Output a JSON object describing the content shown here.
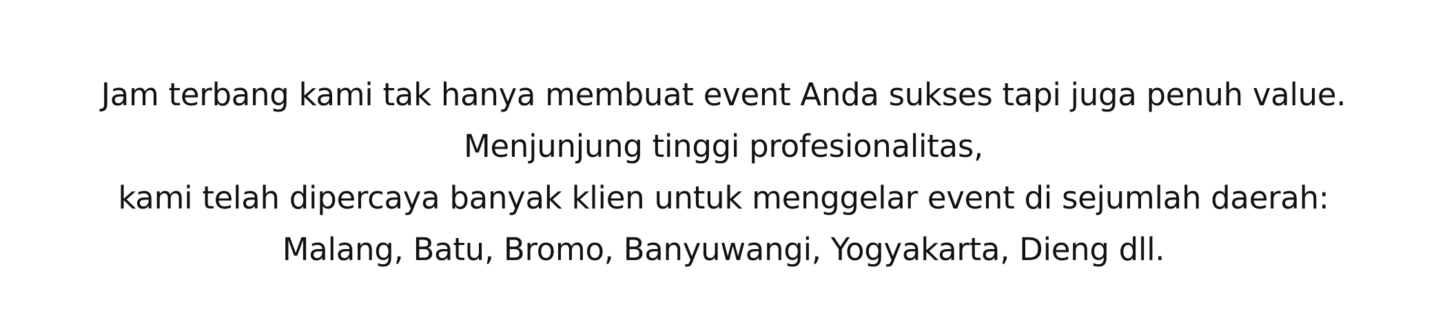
{
  "lines": [
    "Jam terbang kami tak hanya membuat event Anda sukses tapi juga penuh value.",
    "Menjunjung tinggi profesionalitas,",
    "kami telah dipercaya banyak klien untuk menggelar event di sejumlah daerah:",
    "Malang, Batu, Bromo, Banyuwangi, Yogyakarta, Dieng dll."
  ]
}
